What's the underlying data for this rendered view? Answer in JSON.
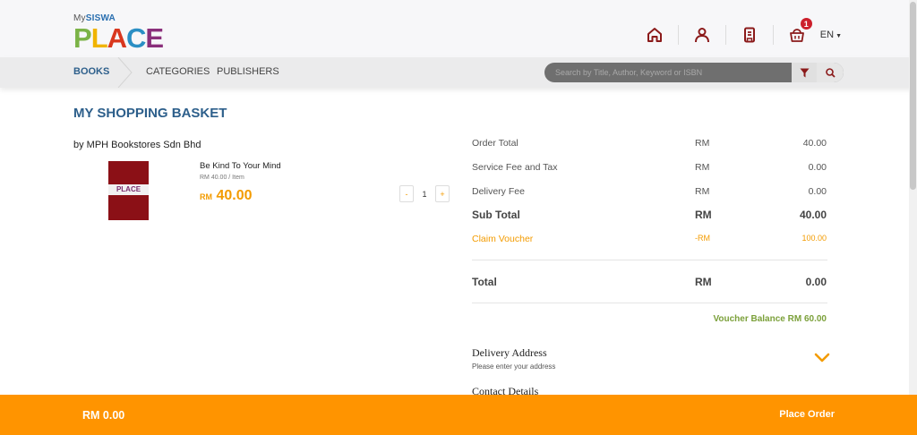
{
  "logo": {
    "small_prefix": "My",
    "small_name": "SISWA",
    "word": "PLACE",
    "letters": [
      "P",
      "L",
      "A",
      "C",
      "E"
    ]
  },
  "header": {
    "icons": [
      "home-icon",
      "user-icon",
      "book-icon",
      "basket-icon"
    ],
    "basket_count": "1",
    "language": "EN"
  },
  "nav": {
    "items": [
      "BOOKS",
      "CATEGORIES",
      "PUBLISHERS"
    ],
    "search_placeholder": "Search by Title, Author, Keyword or ISBN"
  },
  "page": {
    "title": "MY SHOPPING BASKET"
  },
  "basket": {
    "seller": "by MPH Bookstores Sdn Bhd",
    "item": {
      "title": "Be Kind To Your Mind",
      "unit_price": "RM 40.00 / Item",
      "price_currency": "RM",
      "price_amount": "40.00",
      "qty_minus": "-",
      "quantity": "1",
      "qty_plus": "+"
    }
  },
  "summary": {
    "rows": [
      {
        "label": "Order Total",
        "currency": "RM",
        "value": "40.00"
      },
      {
        "label": "Service Fee and Tax",
        "currency": "RM",
        "value": "0.00"
      },
      {
        "label": "Delivery Fee",
        "currency": "RM",
        "value": "0.00"
      },
      {
        "label": "Sub Total",
        "currency": "RM",
        "value": "40.00"
      },
      {
        "label": "Claim Voucher",
        "currency": "-RM",
        "value": "100.00"
      }
    ],
    "total": {
      "label": "Total",
      "currency": "RM",
      "value": "0.00"
    },
    "voucher_balance": "Voucher Balance RM 60.00",
    "delivery_title": "Delivery Address",
    "delivery_sub": "Please enter your address",
    "contact_title": "Contact Details"
  },
  "footer": {
    "total": "RM 0.00",
    "place_order": "Place Order"
  },
  "colors": {
    "brand_blue": "#2d5f8b",
    "accent_orange": "#ff9400",
    "icon_red": "#8b1a1a",
    "voucher_green": "#7ba03a"
  }
}
